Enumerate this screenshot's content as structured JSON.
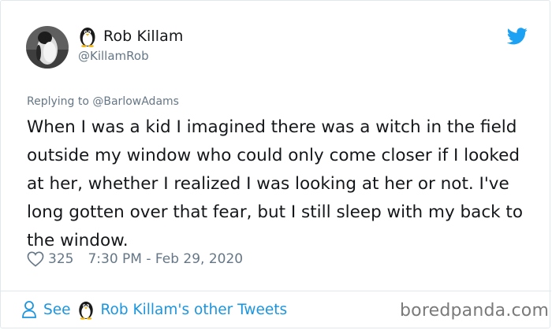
{
  "tweet": {
    "display_name": "Rob Killam",
    "handle": "@KillamRob",
    "reply_context": "Replying to @BarlowAdams",
    "text": "When I was a kid I imagined there was a witch in the field outside my window who could only come closer if I looked at her, whether I realized I was looking at her or not. I've long gotten over that fear, but I still sleep with my back to the window.",
    "likes": "325",
    "timestamp": "7:30 PM - Feb 29, 2020"
  },
  "footer": {
    "see_label": "See",
    "others_label": "Rob Killam's other Tweets"
  },
  "watermark": "boredpanda.com",
  "icons": {
    "emoji": "penguin-icon",
    "brand": "twitter-bird-icon",
    "like": "heart-icon",
    "profile": "person-icon"
  },
  "colors": {
    "link": "#1b95e0",
    "twitter_blue": "#1da1f2",
    "muted": "#657786",
    "text": "#14171a",
    "border": "#e1e8ed"
  }
}
